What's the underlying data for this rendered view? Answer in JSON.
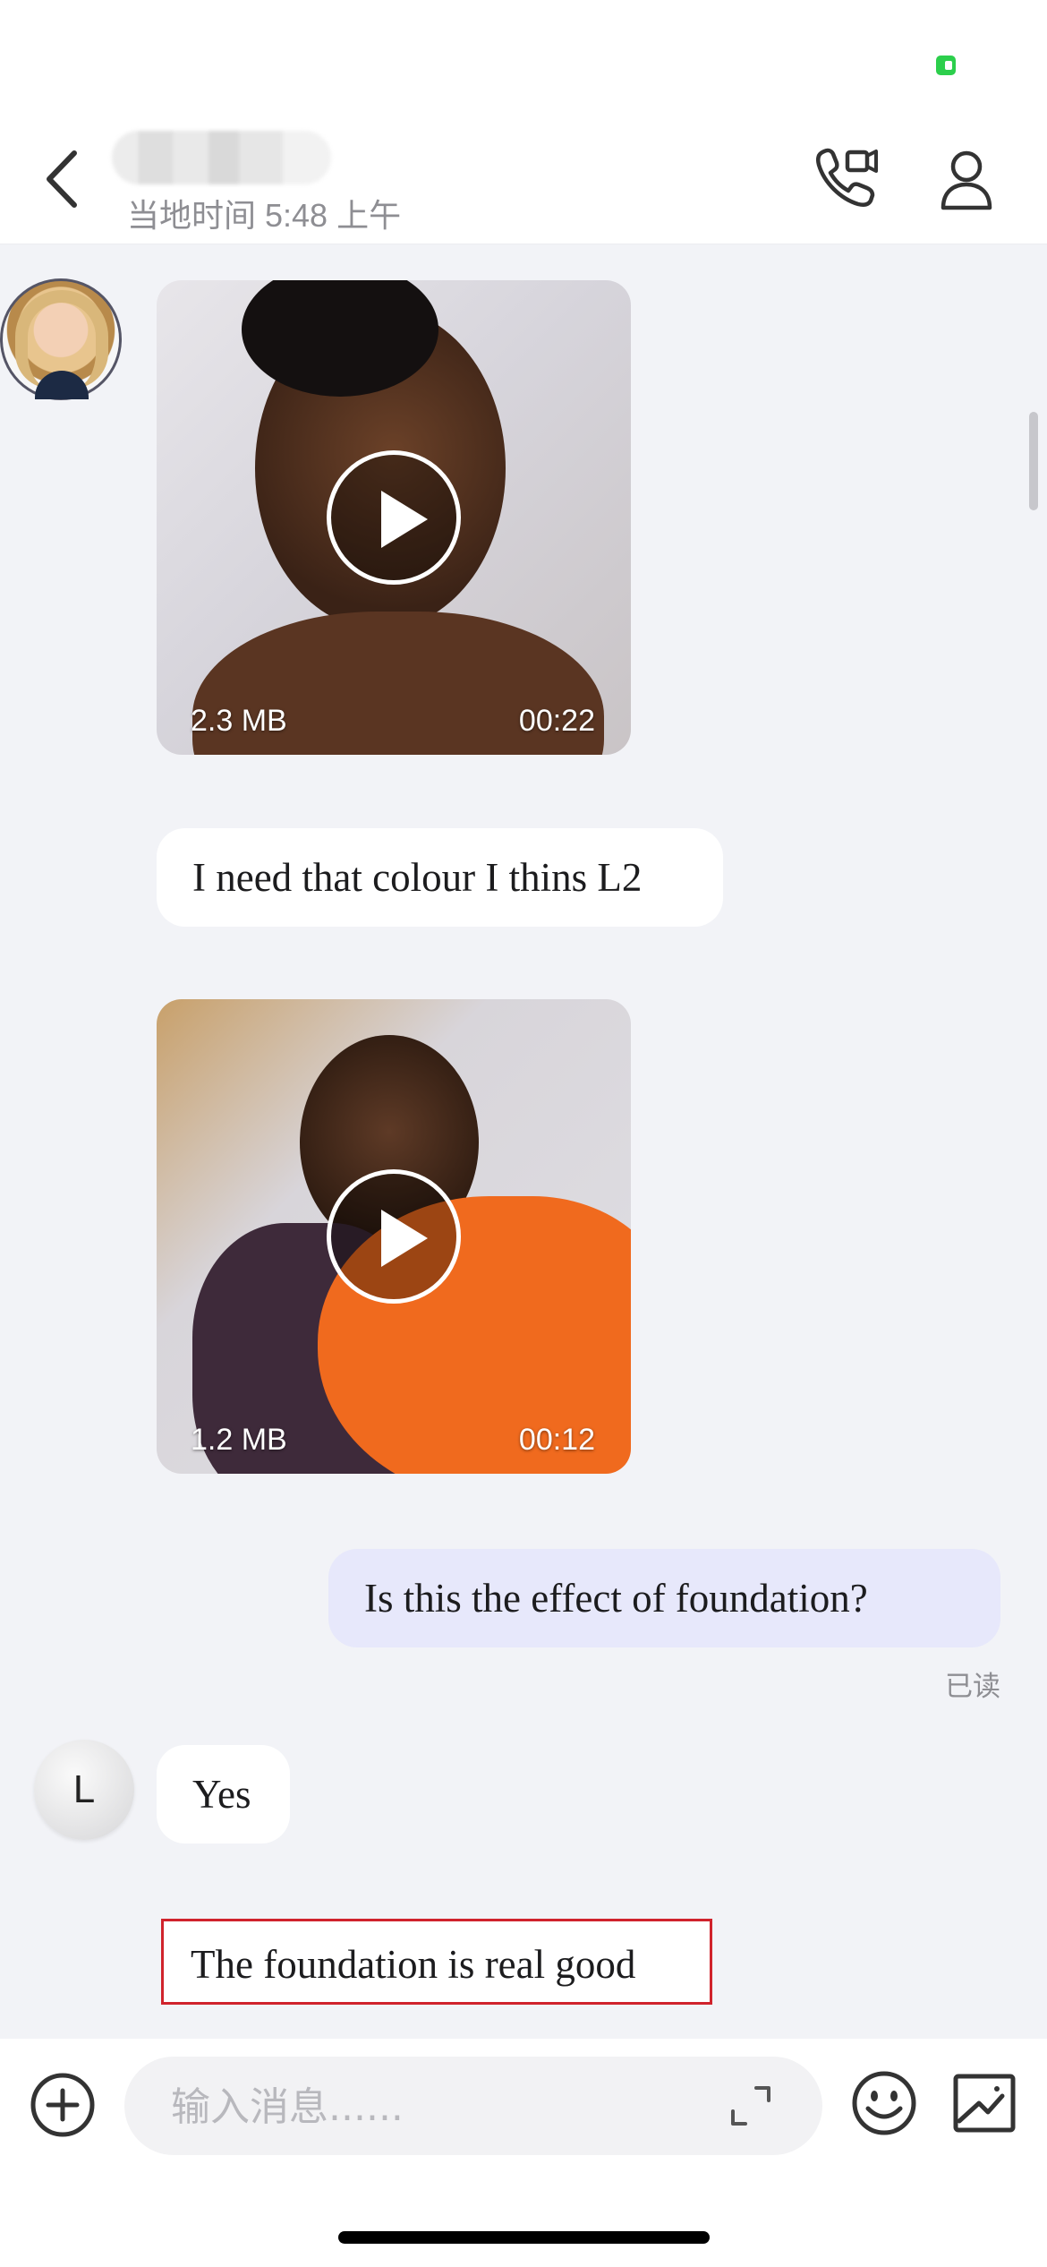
{
  "header": {
    "back_icon": "chevron-left-icon",
    "local_time": "当地时间 5:48 上午",
    "call_icon": "video-call-icon",
    "profile_icon": "person-icon"
  },
  "messages": {
    "video1": {
      "size": "2.3 MB",
      "duration": "00:22"
    },
    "text1": "I need that colour I thins L2",
    "video2": {
      "size": "1.2 MB",
      "duration": "00:12"
    },
    "text2": "Is this the effect of foundation?",
    "read_status": "已读",
    "avatar_initial": "L",
    "text3": "Yes",
    "text4": "The foundation is real good"
  },
  "input": {
    "placeholder": "输入消息......",
    "plus_icon": "plus-circle-icon",
    "expand_icon": "expand-icon",
    "emoji_icon": "emoji-icon",
    "image_icon": "image-icon"
  },
  "colors": {
    "chat_bg": "#f2f3f7",
    "outgoing_bubble": "#e7e8fb",
    "highlight_border": "#d0232c",
    "battery": "#2ccf4c"
  }
}
